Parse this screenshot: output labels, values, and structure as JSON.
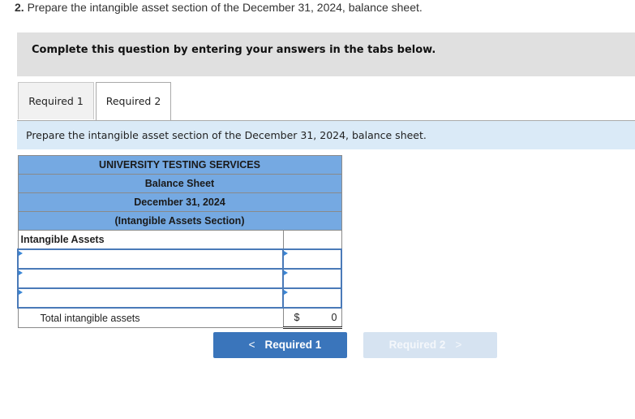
{
  "question": {
    "number": "2.",
    "text": "Prepare the intangible asset section of the December 31, 2024, balance sheet."
  },
  "instruction": "Complete this question by entering your answers in the tabs below.",
  "tabs": [
    {
      "label": "Required 1",
      "active": false
    },
    {
      "label": "Required 2",
      "active": true
    }
  ],
  "prompt": "Prepare the intangible asset section of the December 31, 2024, balance sheet.",
  "balance_sheet": {
    "company": "UNIVERSITY TESTING SERVICES",
    "statement": "Balance Sheet",
    "date": "December 31, 2024",
    "section": "(Intangible Assets Section)",
    "section_label": "Intangible Assets",
    "rows": [
      {
        "name": "",
        "amount": ""
      },
      {
        "name": "",
        "amount": ""
      },
      {
        "name": "",
        "amount": ""
      }
    ],
    "total_label": "Total intangible assets",
    "total_currency": "$",
    "total_value": "0"
  },
  "nav": {
    "prev_label": "Required 1",
    "prev_icon": "chevron-left-icon",
    "prev_glyph": "<",
    "next_label": "Required 2",
    "next_icon": "chevron-right-icon",
    "next_glyph": ">"
  }
}
